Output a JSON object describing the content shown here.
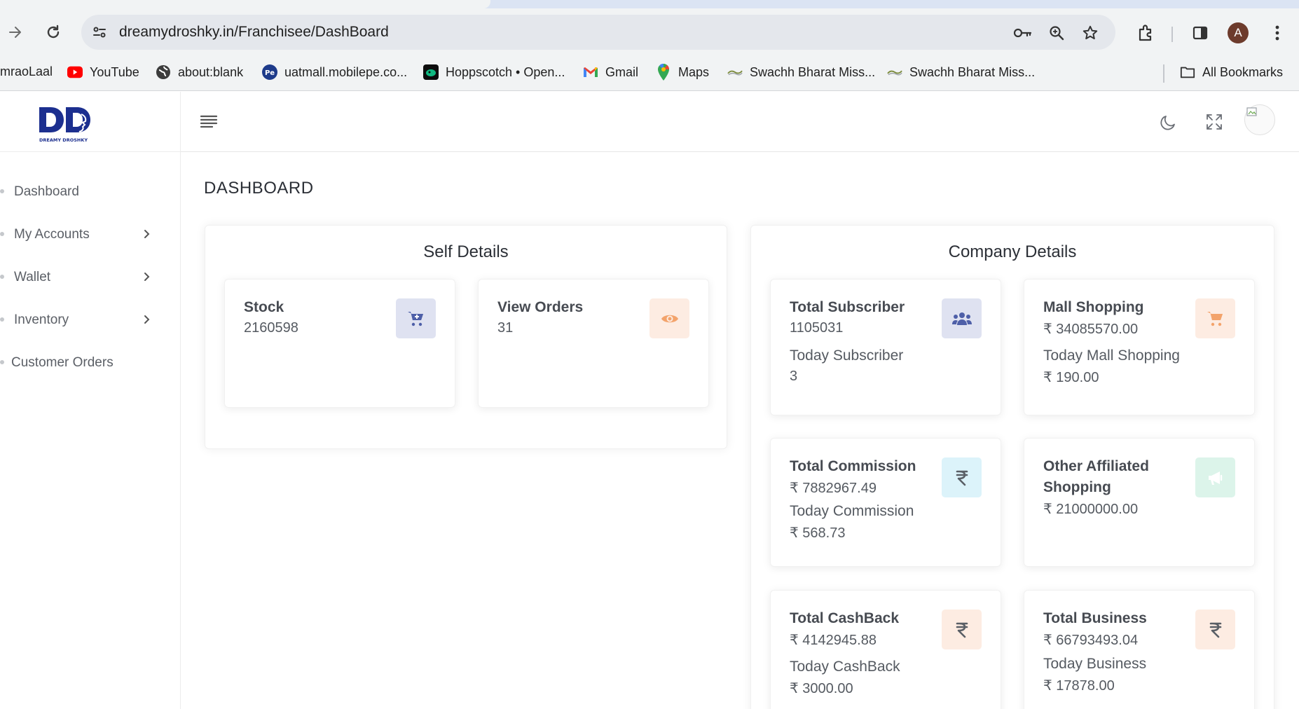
{
  "browser": {
    "url": "dreamydroshky.in/Franchisee/DashBoard",
    "avatar_letter": "A",
    "bookmarks": [
      {
        "label": "mraoLaal",
        "icon": "none"
      },
      {
        "label": "YouTube",
        "icon": "youtube-icon"
      },
      {
        "label": "about:blank",
        "icon": "globe-icon"
      },
      {
        "label": "uatmall.mobilepe.co...",
        "icon": "phonepe-icon"
      },
      {
        "label": "Hoppscotch • Open...",
        "icon": "hoppscotch-icon"
      },
      {
        "label": "Gmail",
        "icon": "gmail-icon"
      },
      {
        "label": "Maps",
        "icon": "maps-icon"
      },
      {
        "label": "Swachh Bharat Miss...",
        "icon": "swachh-bharat-icon"
      },
      {
        "label": "Swachh Bharat Miss...",
        "icon": "swachh-bharat-icon"
      }
    ],
    "all_bookmarks": "All Bookmarks"
  },
  "app": {
    "brand_text": "DREAMY DROSHKY",
    "sidebar": {
      "items": [
        {
          "label": "Dashboard",
          "has_submenu": false
        },
        {
          "label": "My Accounts",
          "has_submenu": true
        },
        {
          "label": "Wallet",
          "has_submenu": true
        },
        {
          "label": "Inventory",
          "has_submenu": true
        },
        {
          "label": "Customer Orders",
          "has_submenu": false
        }
      ]
    },
    "page_title": "DASHBOARD",
    "self_details": {
      "title": "Self Details",
      "cards": [
        {
          "label": "Stock",
          "value": "2160598",
          "icon": "cart-plus-icon",
          "icon_bg": "#dfe2f1",
          "icon_color": "#4e5fa8"
        },
        {
          "label": "View Orders",
          "value": "31",
          "icon": "eye-icon",
          "icon_bg": "#fdece2",
          "icon_color": "#f3a36b"
        }
      ]
    },
    "company_details": {
      "title": "Company Details",
      "cards": [
        {
          "label": "Total Subscriber",
          "value": "1105031",
          "sub_label": "Today Subscriber",
          "sub_value": "3",
          "icon": "users-icon",
          "icon_bg": "#dfe2f1",
          "icon_color": "#4e5fa8"
        },
        {
          "label": "Mall Shopping",
          "value": "₹ 34085570.00",
          "sub_label": "Today Mall Shopping",
          "sub_value": "₹ 190.00",
          "icon": "cart-icon",
          "icon_bg": "#fdece2",
          "icon_color": "#f3a36b"
        },
        {
          "label": "Total Commission",
          "value": "₹ 7882967.49",
          "sub_label": "Today Commission",
          "sub_value": "₹ 568.73",
          "icon": "rupee-icon",
          "icon_bg": "#dcf3fa",
          "icon_color": "#5a5f66"
        },
        {
          "label": "Other Affiliated",
          "label2": "Shopping",
          "value": "₹ 21000000.00",
          "icon": "megaphone-icon",
          "icon_bg": "#dcf4ea",
          "icon_color": "#ffffff"
        },
        {
          "label": "Total CashBack",
          "value": "₹ 4142945.88",
          "sub_label": "Today CashBack",
          "sub_value": "₹ 3000.00",
          "icon": "rupee-icon",
          "icon_bg": "#fdece2",
          "icon_color": "#5a5f66"
        },
        {
          "label": "Total Business",
          "value": "₹ 66793493.04",
          "sub_label": "Today Business",
          "sub_value": "₹ 17878.00",
          "icon": "rupee-icon",
          "icon_bg": "#fdece2",
          "icon_color": "#5a5f66"
        }
      ]
    }
  }
}
